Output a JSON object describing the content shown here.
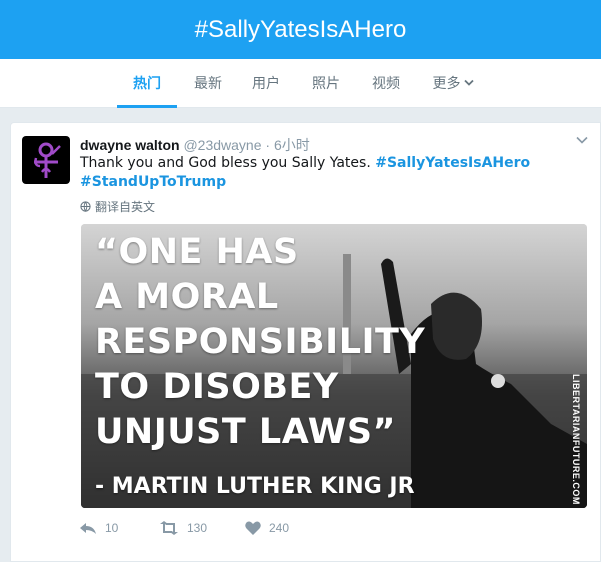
{
  "header": {
    "title": "#SallyYatesIsAHero"
  },
  "tabs": [
    {
      "label": "热门",
      "active": true
    },
    {
      "label": "最新"
    },
    {
      "label": "用户"
    },
    {
      "label": "照片"
    },
    {
      "label": "视频"
    },
    {
      "label": "更多"
    }
  ],
  "tweet": {
    "avatar_icon": "prince-symbol-icon",
    "name": "dwayne walton",
    "handle": "@23dwayne",
    "time": "· 6小时",
    "text_prefix": "Thank you and God bless you Sally Yates.",
    "hashtag1": "#SallyYatesIsAHero",
    "hashtag2": "#StandUpToTrump",
    "translate_label": "翻译自英文",
    "image": {
      "quote_lines": [
        "“ONE HAS",
        "A MORAL",
        "RESPONSIBILITY",
        "TO DISOBEY",
        "UNJUST LAWS”"
      ],
      "attribution": "- MARTIN LUTHER KING JR",
      "credit": "LIBERTARIANFUTURE.COM"
    },
    "actions": {
      "reply_count": "10",
      "retweet_count": "130",
      "like_count": "240"
    }
  },
  "colors": {
    "brand": "#1da1f2",
    "link": "#1b95e0",
    "avatar_symbol": "#a14bc9"
  }
}
